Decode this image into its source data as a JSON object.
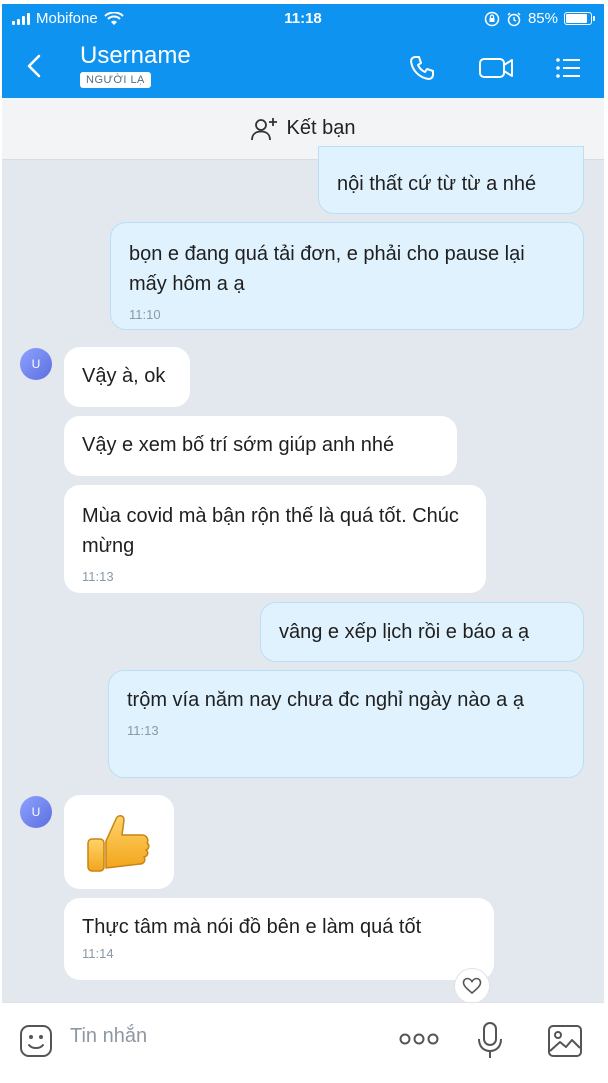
{
  "status": {
    "carrier": "Mobifone",
    "time": "11:18",
    "battery": "85%"
  },
  "header": {
    "title": "Username",
    "badge": "NGƯỜI LẠ"
  },
  "add_friend": {
    "label": "Kết bạn"
  },
  "messages": [
    {
      "text": "nội thất cứ từ từ a nhé"
    },
    {
      "text": "bọn e đang quá tải đơn, e phải cho pause lại mấy hôm a ạ",
      "time": "11:10"
    },
    {
      "text": "Vậy à, ok"
    },
    {
      "text": "Vậy e xem bố trí sớm giúp anh nhé"
    },
    {
      "text": "Mùa covid mà bận rộn thế là quá tốt. Chúc mừng",
      "time": "11:13"
    },
    {
      "text": "vâng e xếp lịch rồi e báo a ạ"
    },
    {
      "text": "trộm vía năm nay chưa đc nghỉ ngày nào a ạ",
      "time": "11:13"
    },
    {
      "sticker": "thumbs-up"
    },
    {
      "text": "Thực tâm mà nói đồ bên e làm quá tốt",
      "time": "11:14"
    }
  ],
  "avatar_initial": "U",
  "input": {
    "placeholder": "Tin nhắn"
  },
  "colors": {
    "header": "#0f93f0",
    "sent_bubble": "#dff2fd",
    "background": "#e3e8ee"
  }
}
